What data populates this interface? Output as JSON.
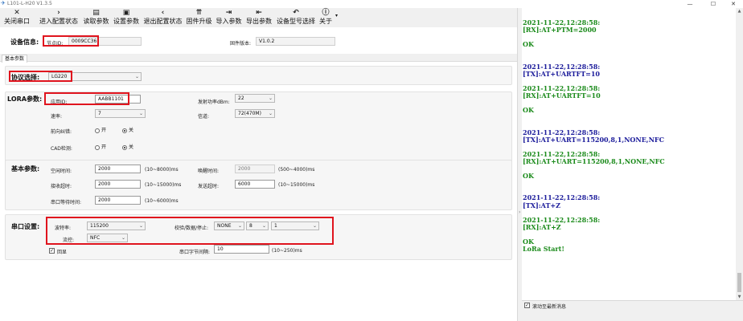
{
  "window": {
    "title": "L101-L-H20 V1.3.5",
    "minimize": "—",
    "maximize": "☐",
    "close": "✕"
  },
  "toolbar": [
    {
      "label": "关闭串口",
      "icon": "✕"
    },
    {
      "label": "进入配置状态",
      "icon": "›"
    },
    {
      "label": "读取参数",
      "icon": "▤"
    },
    {
      "label": "设置参数",
      "icon": "▣"
    },
    {
      "label": "退出配置状态",
      "icon": "‹"
    },
    {
      "label": "固件升级",
      "icon": "⇈"
    },
    {
      "label": "导入参数",
      "icon": "⇥"
    },
    {
      "label": "导出参数",
      "icon": "⇤"
    },
    {
      "label": "设备型号选择",
      "icon": "↶"
    },
    {
      "label": "关于",
      "icon": "ⓘ"
    }
  ],
  "toolbar_more": "▾",
  "device": {
    "section_label": "设备信息:",
    "node_id_label": "节点ID:",
    "node_id_value": "0009CC36",
    "firmware_label": "固件版本:",
    "firmware_value": "V1.0.2"
  },
  "tab": "基本参数",
  "protocol": {
    "label": "协议选择:",
    "value": "LG220"
  },
  "lora": {
    "section_label": "LORA参数:",
    "app_id_label": "应用ID:",
    "app_id_value": "AABB1101",
    "tx_power_label": "发射功率dBm:",
    "tx_power_value": "22",
    "rate_label": "速率:",
    "rate_value": "7",
    "channel_label": "信道:",
    "channel_value": "72(470M)",
    "fec_label": "前向纠错:",
    "fec_on": "开",
    "fec_off": "关",
    "cad_label": "CAD检测:",
    "cad_on": "开",
    "cad_off": "关"
  },
  "basic": {
    "section_label": "基本参数:",
    "interval_label": "空闲时间:",
    "interval_value": "2000",
    "interval_unit": "(10~8000)ms",
    "wake_label": "唤醒时间:",
    "wake_value": "2000",
    "wake_unit": "(500~4000)ms",
    "rx_timeout_label": "接收超时:",
    "rx_timeout_value": "2000",
    "rx_timeout_unit": "(10~15000)ms",
    "tx_timeout_label": "发送超时:",
    "tx_timeout_value": "6000",
    "tx_timeout_unit": "(10~15000)ms",
    "serial_wait_label": "串口等待时间:",
    "serial_wait_value": "2000",
    "serial_wait_unit": "(10~6000)ms"
  },
  "serial": {
    "section_label": "串口设置:",
    "baud_label": "波特率:",
    "baud_value": "115200",
    "parity_label": "校验/数据/停止:",
    "parity_value": "NONE",
    "data_bits_value": "8",
    "stop_bits_value": "1",
    "flow_label": "流控:",
    "flow_value": "NFC",
    "echo_label": "回显",
    "byte_interval_label": "串口字节间隔:",
    "byte_interval_value": "10",
    "byte_interval_unit": "(10~250)ms"
  },
  "log": [
    {
      "text": "2021-11-22,12:28:58:",
      "kind": "rx"
    },
    {
      "text": "[RX]:AT+PTM=2000",
      "kind": "rx"
    },
    {
      "text": "",
      "kind": "rx"
    },
    {
      "text": "OK",
      "kind": "rx"
    },
    {
      "text": "",
      "kind": "rx"
    },
    {
      "text": "",
      "kind": "rx"
    },
    {
      "text": "2021-11-22,12:28:58:",
      "kind": "tx"
    },
    {
      "text": "[TX]:AT+UARTFT=10",
      "kind": "tx"
    },
    {
      "text": "",
      "kind": "rx"
    },
    {
      "text": "2021-11-22,12:28:58:",
      "kind": "rx"
    },
    {
      "text": "[RX]:AT+UARTFT=10",
      "kind": "rx"
    },
    {
      "text": "",
      "kind": "rx"
    },
    {
      "text": "OK",
      "kind": "rx"
    },
    {
      "text": "",
      "kind": "rx"
    },
    {
      "text": "",
      "kind": "rx"
    },
    {
      "text": "2021-11-22,12:28:58:",
      "kind": "tx"
    },
    {
      "text": "[TX]:AT+UART=115200,8,1,NONE,NFC",
      "kind": "tx"
    },
    {
      "text": "",
      "kind": "rx"
    },
    {
      "text": "2021-11-22,12:28:58:",
      "kind": "rx"
    },
    {
      "text": "[RX]:AT+UART=115200,8,1,NONE,NFC",
      "kind": "rx"
    },
    {
      "text": "",
      "kind": "rx"
    },
    {
      "text": "OK",
      "kind": "rx"
    },
    {
      "text": "",
      "kind": "rx"
    },
    {
      "text": "",
      "kind": "rx"
    },
    {
      "text": "2021-11-22,12:28:58:",
      "kind": "tx"
    },
    {
      "text": "[TX]:AT+Z",
      "kind": "tx"
    },
    {
      "text": "",
      "kind": "rx"
    },
    {
      "text": "2021-11-22,12:28:58:",
      "kind": "rx"
    },
    {
      "text": "[RX]:AT+Z",
      "kind": "rx"
    },
    {
      "text": "",
      "kind": "rx"
    },
    {
      "text": "OK",
      "kind": "rx"
    },
    {
      "text": "LoRa Start!",
      "kind": "rx"
    }
  ],
  "autoscroll_label": "滚动至最新消息",
  "colors": {
    "log_rx": "#1a8a1a",
    "log_tx": "#1a1a9a",
    "highlight": "#e0141e"
  }
}
